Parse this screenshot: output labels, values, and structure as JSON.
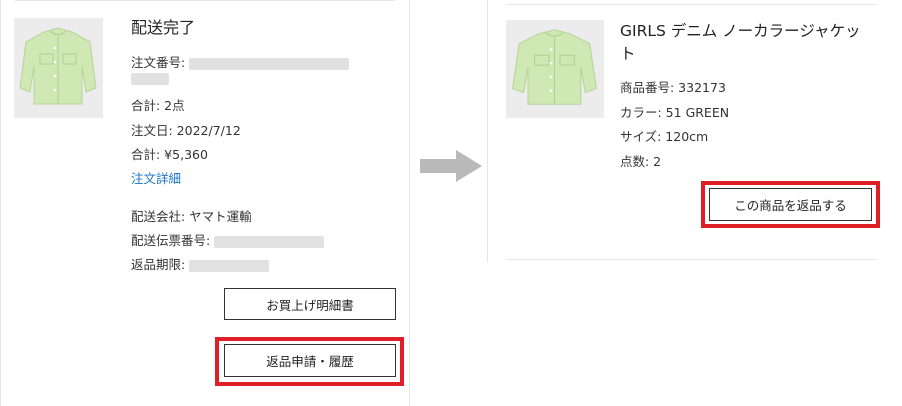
{
  "order": {
    "status": "配送完了",
    "order_number_label": "注文番号:",
    "total_qty_label": "合計: 2点",
    "order_date_label": "注文日: 2022/7/12",
    "total_price_label": "合計: ¥5,360",
    "detail_link": "注文詳細",
    "carrier_label": "配送会社: ヤマト運輸",
    "tracking_label": "配送伝票番号:",
    "return_deadline_label": "返品期限:",
    "receipt_button": "お買上げ明細書",
    "return_button": "返品申請・履歴"
  },
  "product": {
    "title": "GIRLS デニム ノーカラージャケット",
    "item_number": "商品番号: 332173",
    "color": "カラー: 51 GREEN",
    "size": "サイズ: 120cm",
    "qty": "点数: 2",
    "return_item_button": "この商品を返品する"
  },
  "colors": {
    "highlight": "#e01e26",
    "link": "#1a73c8",
    "jacket": "#cfe8b4"
  },
  "icons": {
    "jacket_image": "green-jacket-image",
    "arrow": "right-arrow-icon"
  }
}
